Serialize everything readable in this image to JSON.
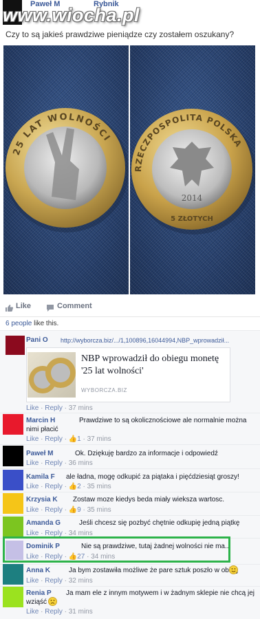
{
  "header": {
    "poster_name": "Paweł M",
    "location_name": "Rybnik",
    "watermark": "www.wiocha.pl",
    "question": "Czy to są jakieś prawdziwe pieniądze czy zostałem oszukany?"
  },
  "photos": {
    "left_coin": {
      "ring_text": "25 LAT WOLNOŚCI"
    },
    "right_coin": {
      "ring_text": "RZECZPOSPOLITA POLSKA",
      "year": "2014",
      "value": "5 ZŁOTYCH"
    }
  },
  "actions": {
    "like": "Like",
    "comment": "Comment"
  },
  "likes": {
    "count_link": "6 people",
    "suffix": " like this."
  },
  "comments": [
    {
      "name": "Pani O",
      "text": "http://wyborcza.biz/.../1,100896,16044994,NBP_wprowadził...",
      "is_link": true,
      "preview": {
        "title": "NBP wprowadził do obiegu monetę '25 lat wolności'",
        "domain": "WYBORCZA.BIZ"
      },
      "like": "Like",
      "reply": "Reply",
      "likes": "",
      "time": "37 mins",
      "avatar": "#8b0a1e"
    },
    {
      "name": "Marcin H",
      "text": "Prawdziwe to są okolicznościowe ale normalnie można",
      "text2": "nimi płacić",
      "like": "Like",
      "reply": "Reply",
      "likes": "1",
      "time": "37 mins",
      "avatar": "#e8192c"
    },
    {
      "name": "Paweł M",
      "text": "Ok. Dziękuję bardzo za informacje i odpowiedź",
      "like": "Like",
      "reply": "Reply",
      "likes": "",
      "time": "36 mins",
      "avatar": "#000000"
    },
    {
      "name": "Kamila F",
      "text": "ale ładna, mogę odkupić za piątaka i pięćdziesiąt groszy!",
      "like": "Like",
      "reply": "Reply",
      "likes": "2",
      "time": "35 mins",
      "avatar": "#3a4fc8"
    },
    {
      "name": "Krzysia K",
      "text": "Zostaw moze kiedys beda miały wieksza wartosc.",
      "like": "Like",
      "reply": "Reply",
      "likes": "9",
      "time": "35 mins",
      "avatar": "#f5c518"
    },
    {
      "name": "Amanda G",
      "text": "Jeśli chcesz się pozbyć chętnie odkupię jedną piątkę",
      "like": "Like",
      "reply": "Reply",
      "likes": "",
      "time": "34 mins",
      "avatar": "#7cc520"
    },
    {
      "name": "Dominik P",
      "text": "Nie są prawdziwe, tutaj żadnej wolności nie ma...",
      "like": "Like",
      "reply": "Reply",
      "likes": "27",
      "time": "34 mins",
      "avatar": "#c5c0e6"
    },
    {
      "name": "Anna K",
      "text": "Ja bym zostawiła możliwe że pare sztuk poszło w obieg",
      "like": "Like",
      "reply": "Reply",
      "likes": "",
      "time": "32 mins",
      "avatar": "#1d7f80"
    },
    {
      "name": "Renia P",
      "text": "Ja mam ele z innym motywem i w żadnym sklepie nie chcą jej",
      "text2": "wziąść",
      "like": "Like",
      "reply": "Reply",
      "likes": "",
      "time": "31 mins",
      "avatar": "#9be21f"
    }
  ],
  "colors": {
    "link": "#3b5998",
    "highlight": "#2db34a",
    "meta": "#9197a3"
  },
  "icons": {
    "like": "thumbs-up-icon",
    "comment": "speech-bubble-icon",
    "smiley": "smiley-icon"
  }
}
